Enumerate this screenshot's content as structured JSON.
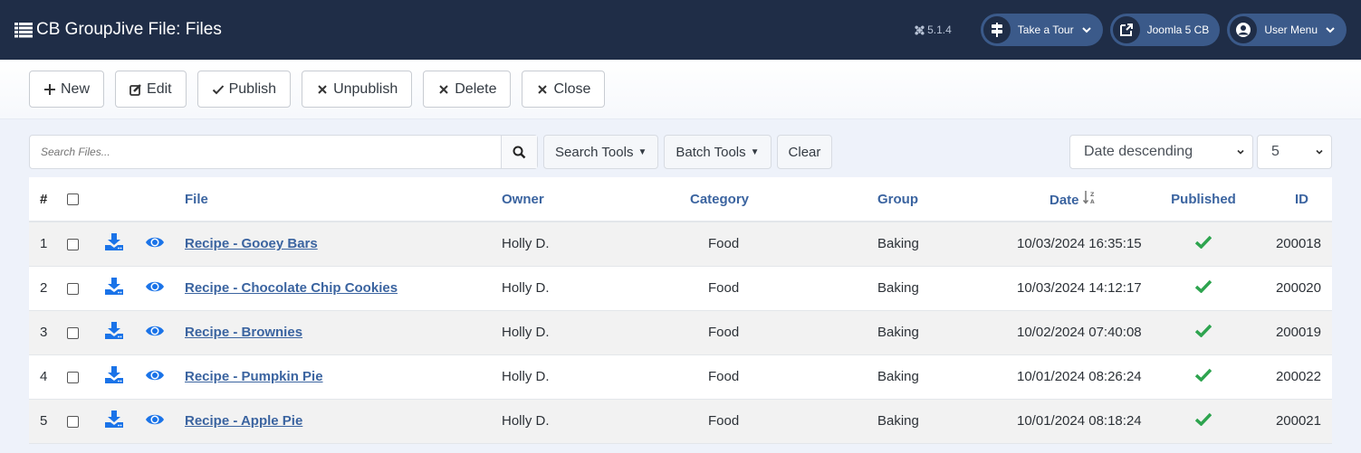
{
  "header": {
    "title": "CB GroupJive File: Files",
    "version": "5.1.4",
    "take_tour": "Take a Tour",
    "site_link": "Joomla 5 CB",
    "user_menu": "User Menu"
  },
  "toolbar": {
    "new": "New",
    "edit": "Edit",
    "publish": "Publish",
    "unpublish": "Unpublish",
    "delete": "Delete",
    "close": "Close"
  },
  "filters": {
    "search_placeholder": "Search Files...",
    "search_tools": "Search Tools",
    "batch_tools": "Batch Tools",
    "clear": "Clear",
    "ordering": "Date descending",
    "limit": "5"
  },
  "table": {
    "headers": {
      "num": "#",
      "file": "File",
      "owner": "Owner",
      "category": "Category",
      "group": "Group",
      "date": "Date",
      "published": "Published",
      "id": "ID"
    },
    "rows": [
      {
        "num": "1",
        "file": "Recipe - Gooey Bars",
        "owner": "Holly D.",
        "category": "Food",
        "group": "Baking",
        "date": "10/03/2024 16:35:15",
        "published": true,
        "id": "200018"
      },
      {
        "num": "2",
        "file": "Recipe - Chocolate Chip Cookies",
        "owner": "Holly D.",
        "category": "Food",
        "group": "Baking",
        "date": "10/03/2024 14:12:17",
        "published": true,
        "id": "200020"
      },
      {
        "num": "3",
        "file": "Recipe - Brownies",
        "owner": "Holly D.",
        "category": "Food",
        "group": "Baking",
        "date": "10/02/2024 07:40:08",
        "published": true,
        "id": "200019"
      },
      {
        "num": "4",
        "file": "Recipe - Pumpkin Pie",
        "owner": "Holly D.",
        "category": "Food",
        "group": "Baking",
        "date": "10/01/2024 08:26:24",
        "published": true,
        "id": "200022"
      },
      {
        "num": "5",
        "file": "Recipe - Apple Pie",
        "owner": "Holly D.",
        "category": "Food",
        "group": "Baking",
        "date": "10/01/2024 08:18:24",
        "published": true,
        "id": "200021"
      }
    ]
  },
  "colors": {
    "header_bg": "#1f2d47",
    "pill_bg": "#3b5a8a",
    "link": "#3b64a0",
    "icon_blue": "#1a73e8",
    "published_green": "#2ea44f"
  }
}
